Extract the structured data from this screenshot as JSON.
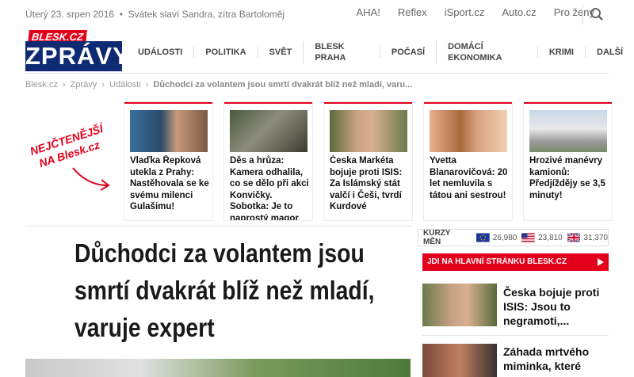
{
  "topbar": {
    "date": "Úterý 23. srpen 2016",
    "nameday": "Svátek slaví Sandra, zítra Bartoloměj",
    "links": [
      "AHA!",
      "Reflex",
      "iSport.cz",
      "Auto.cz",
      "Pro ženy"
    ]
  },
  "logo": {
    "brand": "BLESK.CZ",
    "section": "ZPRÁVY"
  },
  "nav": [
    "UDÁLOSTI",
    "POLITIKA",
    "SVĚT",
    "BLESK PRAHA",
    "POČASÍ",
    "DOMÁCÍ EKONOMIKA",
    "KRIMI",
    "DALŠÍ"
  ],
  "breadcrumb": [
    "Blesk.cz",
    "Zprávy",
    "Události",
    "Důchodci za volantem jsou smrtí dvakrát blíž než mladí, varu..."
  ],
  "most_read_label": "NEJČTENĚJŠÍ NA Blesk.cz",
  "cards": [
    {
      "title": "Vlaďka Řepková utekla z Prahy: Nastěhovala se ke svému milenci Gulašimu!"
    },
    {
      "title": "Děs a hrůza: Kamera odhalila, co se dělo při akci Konvičky. Sobotka: Je to naprostý magor"
    },
    {
      "title": "Česka Markéta bojuje proti ISIS: Za Islámský stát valčí i Češi, tvrdí Kurdové"
    },
    {
      "title": "Yvetta Blanarovičová: 20 let nemluvila s tátou ani sestrou!"
    },
    {
      "title": "Hrozivé manévry kamionů: Předjíždějy se 3,5 minuty!"
    }
  ],
  "headline": "Důchodci za volantem jsou smrtí dvakrát blíž než mladí, varuje expert",
  "currency": {
    "label": "KURZY MĚN",
    "eur": "26,980",
    "usd": "23,810",
    "gbp": "31,370"
  },
  "main_link": "JDI NA HLAVNÍ STRÁNKU BLESK.CZ",
  "sidebar": [
    {
      "title": "Česka bojuje proti ISIS: Jsou to negramoti,..."
    },
    {
      "title": "Záhada mrtvého miminka, které"
    }
  ],
  "colors": {
    "accent": "#e3001b",
    "brand_blue": "#0e2a73"
  }
}
